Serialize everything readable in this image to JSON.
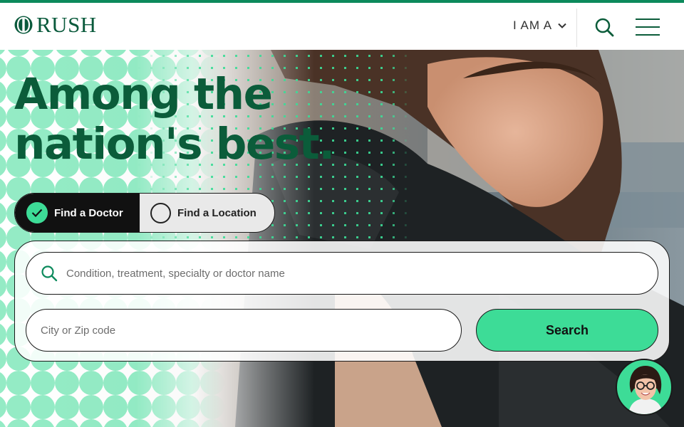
{
  "brand": {
    "name": "RUSH",
    "logo_icon": "rush-logo-mark",
    "primary_color": "#0b5c3a",
    "accent_color": "#3ddc97"
  },
  "header": {
    "iama_label": "I AM A",
    "iama_icon": "chevron-down-icon",
    "search_icon": "search-icon",
    "menu_icon": "hamburger-menu-icon"
  },
  "hero": {
    "headline_line1": "Among the",
    "headline_line2": "nation's best."
  },
  "finder": {
    "tabs": [
      {
        "label": "Find a Doctor",
        "selected": true
      },
      {
        "label": "Find a Location",
        "selected": false
      }
    ],
    "query_placeholder": "Condition, treatment, specialty or doctor name",
    "location_placeholder": "City or Zip code",
    "submit_label": "Search"
  },
  "chat": {
    "icon": "chat-assistant-avatar"
  }
}
